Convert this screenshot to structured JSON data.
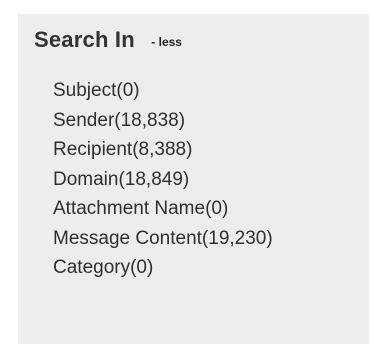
{
  "search_in": {
    "title": "Search In",
    "toggle_label": "- less",
    "items": [
      {
        "label": "Subject(0)"
      },
      {
        "label": "Sender(18,838)"
      },
      {
        "label": "Recipient(8,388)"
      },
      {
        "label": "Domain(18,849)"
      },
      {
        "label": "Attachment Name(0)"
      },
      {
        "label": "Message Content(19,230)"
      },
      {
        "label": "Category(0)"
      }
    ]
  },
  "colors": {
    "panel_background": "#ededed",
    "text": "#2f2f2f"
  }
}
